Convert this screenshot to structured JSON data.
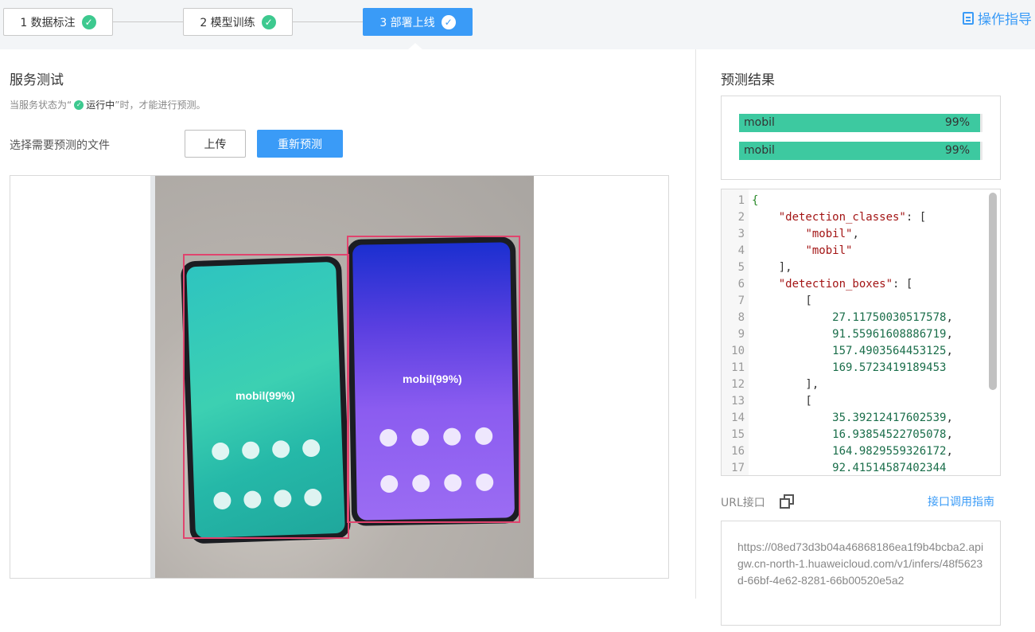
{
  "steps": [
    {
      "label": "1 数据标注",
      "state": "done"
    },
    {
      "label": "2 模型训练",
      "state": "done"
    },
    {
      "label": "3 部署上线",
      "state": "active"
    }
  ],
  "guide_link": "操作指导",
  "service_test": {
    "title": "服务测试",
    "hint_prefix": "当服务状态为“",
    "hint_status": "运行中",
    "hint_suffix": "”时，才能进行预测。",
    "file_label": "选择需要预测的文件",
    "upload_button": "上传",
    "repredict_button": "重新预测",
    "detections": [
      {
        "label": "mobil(99%)"
      },
      {
        "label": "mobil(99%)"
      }
    ]
  },
  "prediction": {
    "title": "预测结果",
    "results": [
      {
        "name": "mobil",
        "percent": "99%",
        "fraction": 0.99
      },
      {
        "name": "mobil",
        "percent": "99%",
        "fraction": 0.99
      }
    ],
    "code_lines": [
      {
        "n": "1",
        "text": "{"
      },
      {
        "n": "2",
        "text": "    \"detection_classes\": ["
      },
      {
        "n": "3",
        "text": "        \"mobil\","
      },
      {
        "n": "4",
        "text": "        \"mobil\""
      },
      {
        "n": "5",
        "text": "    ],"
      },
      {
        "n": "6",
        "text": "    \"detection_boxes\": ["
      },
      {
        "n": "7",
        "text": "        ["
      },
      {
        "n": "8",
        "text": "            27.11750030517578,"
      },
      {
        "n": "9",
        "text": "            91.55961608886719,"
      },
      {
        "n": "10",
        "text": "            157.4903564453125,"
      },
      {
        "n": "11",
        "text": "            169.5723419189453"
      },
      {
        "n": "12",
        "text": "        ],"
      },
      {
        "n": "13",
        "text": "        ["
      },
      {
        "n": "14",
        "text": "            35.39212417602539,"
      },
      {
        "n": "15",
        "text": "            16.93854522705078,"
      },
      {
        "n": "16",
        "text": "            164.9829559326172,"
      },
      {
        "n": "17",
        "text": "            92.41514587402344"
      }
    ]
  },
  "url_section": {
    "label": "URL接口",
    "guide_link": "接口调用指南",
    "url": "https://08ed73d3b04a46868186ea1f9b4bcba2.apigw.cn-north-1.huaweicloud.com/v1/infers/48f5623d-66bf-4e62-8281-66b00520e5a2"
  },
  "colors": {
    "primary": "#3a9bf7",
    "success": "#3dc98f",
    "result_bar": "#3dc9a0",
    "bbox": "#e0446e"
  }
}
